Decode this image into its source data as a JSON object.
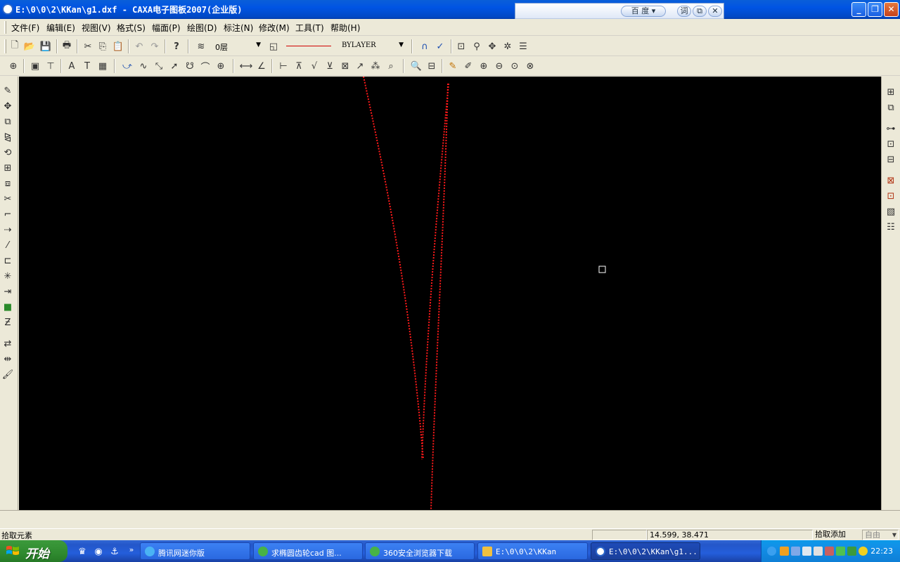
{
  "window": {
    "title": "E:\\0\\0\\2\\KKan\\g1.dxf - CAXA电子图板2007(企业版)",
    "minimize": "_",
    "maximize": "❐",
    "close": "✕"
  },
  "baidu_toolbar": {
    "search_label": "百 度",
    "dict_label": "词",
    "copy_label": "⧉",
    "close_label": "✕"
  },
  "menu": [
    "文件(F)",
    "编辑(E)",
    "视图(V)",
    "格式(S)",
    "幅面(P)",
    "绘图(D)",
    "标注(N)",
    "修改(M)",
    "工具(T)",
    "帮助(H)"
  ],
  "toolbar": {
    "layer_value": "0层",
    "linetype_value": "BYLAYER"
  },
  "icons": {
    "toolbar1": [
      "new-file-icon",
      "open-folder-icon",
      "save-icon",
      "print-icon",
      "cut-icon",
      "copy-icon",
      "paste-icon",
      "undo-icon",
      "redo-icon",
      "help-icon",
      "layer-icon",
      "linetype-icon",
      "snap-icon",
      "snap-settings-icon",
      "zoom-window-icon",
      "zoom-dynamic-icon",
      "pan-icon",
      "zoom-all-icon",
      "properties-icon"
    ],
    "toolbar2": [
      "select-all-icon",
      "frame-icon",
      "title-block-icon",
      "text-style-icon",
      "text-icon",
      "block-icon",
      "line-icon",
      "arc-icon",
      "curve-icon",
      "arrow-icon",
      "circle-icon",
      "ellipse-icon",
      "center-line-icon",
      "dimension-icon",
      "angle-dimension-icon",
      "tolerance-icon",
      "datum-icon",
      "roughness-icon",
      "weld-icon",
      "balloon-icon",
      "leader-icon",
      "hatch-icon",
      "table-icon",
      "zoom-icon",
      "measure-icon",
      "pen-icon",
      "edit-icon",
      "zoom-in-icon",
      "zoom-out-icon",
      "zoom-extents-icon",
      "zoom-previous-icon"
    ],
    "left": [
      "eraser-icon",
      "move-icon",
      "copy-object-icon",
      "mirror-icon",
      "rotate-icon",
      "array-icon",
      "scale-icon",
      "trim-icon",
      "fillet-icon",
      "extend-icon",
      "break-icon",
      "stretch-icon",
      "explode-icon",
      "align-icon",
      "color-icon",
      "hatch-edit-icon",
      "match-icon",
      "format-painter-icon"
    ],
    "right": [
      "block-insert-icon",
      "3d-view-icon",
      "part-library-icon",
      "library-manage-icon",
      "library-import-icon",
      "bom-icon",
      "sheet-icon",
      "sequence-icon",
      "hatch-icon",
      "stack-icon"
    ]
  },
  "status": {
    "prompt": "拾取元素",
    "coordinates": "14.599, 38.471",
    "mode": "拾取添加",
    "snap": "自由"
  },
  "taskbar": {
    "start_label": "开始",
    "more": "»",
    "tasks": [
      "腾讯网迷你版",
      "求椭圆齿轮cad 图...",
      "360安全浏览器下载",
      "E:\\0\\0\\2\\KKan",
      "E:\\0\\0\\2\\KKan\\g1..."
    ],
    "clock": "22:23"
  },
  "colors": {
    "canvas_bg": "#000000",
    "curve": "#ff1a1a",
    "titlebar": "#0054e3"
  }
}
